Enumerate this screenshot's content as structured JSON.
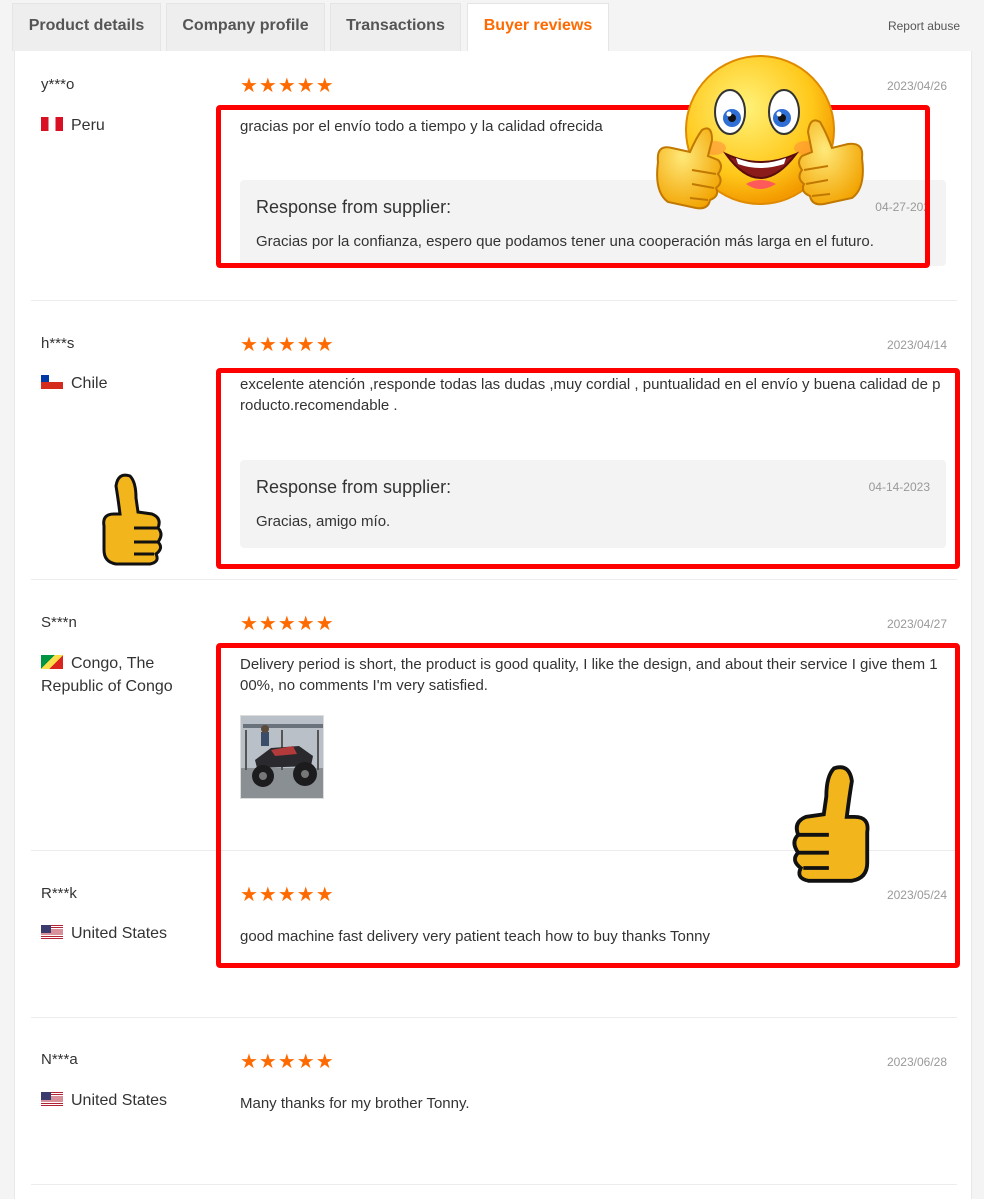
{
  "tabs": [
    {
      "label": "Product details"
    },
    {
      "label": "Company profile"
    },
    {
      "label": "Transactions"
    },
    {
      "label": "Buyer reviews",
      "active": true
    }
  ],
  "report_abuse": "Report abuse",
  "accent_color": "#ff6a00",
  "highlight_color": "#ff0000",
  "stars_display": "★★★★★",
  "reviews": [
    {
      "user": "y***o",
      "country": "Peru",
      "rating": 5,
      "date": "2023/04/26",
      "text": "gracias por el envío todo a tiempo y la calidad ofrecida",
      "response": {
        "title": "Response from supplier:",
        "date": "04-27-202",
        "text": "Gracias por la confianza, espero que podamos tener una cooperación más larga en el futuro."
      }
    },
    {
      "user": "h***s",
      "country": "Chile",
      "rating": 5,
      "date": "2023/04/14",
      "text": "excelente atención ,responde todas las dudas ,muy cordial , puntualidad en el envío y buena calidad de producto.recomendable .",
      "response": {
        "title": "Response from supplier:",
        "date": "04-14-2023",
        "text": "Gracias, amigo mío."
      }
    },
    {
      "user": "S***n",
      "country": "Congo, The Republic of Congo",
      "rating": 5,
      "date": "2023/04/27",
      "text": "Delivery period is short, the product is good quality, I like the design, and about their service I give them 100%, no comments I'm very satisfied.",
      "has_photo": true
    },
    {
      "user": "R***k",
      "country": "United States",
      "rating": 5,
      "date": "2023/05/24",
      "text": "good machine fast delivery very patient teach how to buy thanks Tonny"
    },
    {
      "user": "N***a",
      "country": "United States",
      "rating": 5,
      "date": "2023/06/28",
      "text": "Many thanks for my brother Tonny."
    }
  ]
}
